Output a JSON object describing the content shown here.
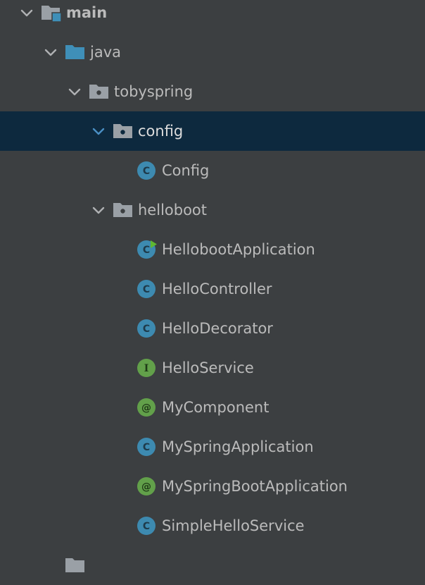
{
  "project_tree": {
    "main": {
      "label": "main"
    },
    "java": {
      "label": "java"
    },
    "tobyspring": {
      "label": "tobyspring"
    },
    "config_pkg": {
      "label": "config"
    },
    "config_class": {
      "label": "Config",
      "kind_letter": "C"
    },
    "helloboot_pkg": {
      "label": "helloboot"
    },
    "items": [
      {
        "label": "HellobootApplication",
        "kind_letter": "C"
      },
      {
        "label": "HelloController",
        "kind_letter": "C"
      },
      {
        "label": "HelloDecorator",
        "kind_letter": "C"
      },
      {
        "label": "HelloService",
        "kind_letter": "I"
      },
      {
        "label": "MyComponent",
        "kind_letter": "@"
      },
      {
        "label": "MySpringApplication",
        "kind_letter": "C"
      },
      {
        "label": "MySpringBootApplication",
        "kind_letter": "@"
      },
      {
        "label": "SimpleHelloService",
        "kind_letter": "C"
      }
    ],
    "colors": {
      "background": "#3c3f41",
      "selected_row": "#0d293e",
      "class_icon": "#3d8ab0",
      "interface_icon": "#62a04a",
      "annotation_icon": "#62a04a",
      "folder_gray": "#9aa0a6",
      "folder_blue": "#3f8fb8",
      "run_marker": "#5fb832"
    },
    "icons": {
      "expanded": "chevron-down-icon",
      "module": "module-folder-icon",
      "source_root": "source-root-folder-icon",
      "package": "package-folder-icon",
      "class": "class-icon",
      "interface": "interface-icon",
      "annotation": "annotation-icon",
      "run_marker": "run-marker-icon"
    }
  }
}
